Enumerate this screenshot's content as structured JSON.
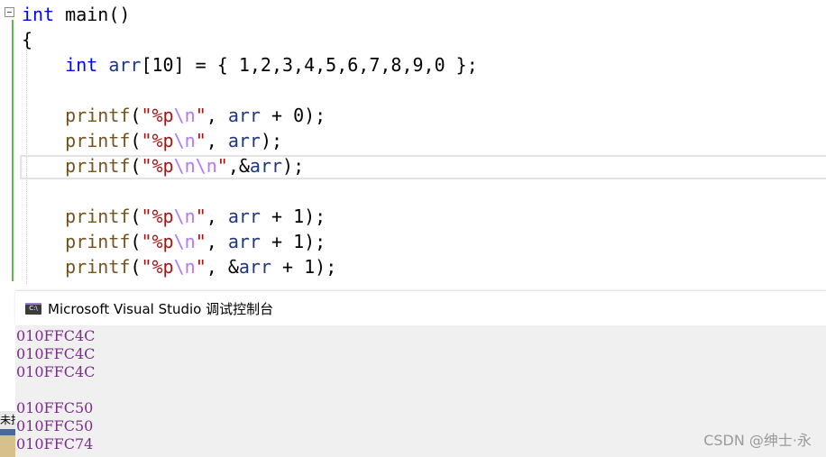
{
  "editor": {
    "lines": [
      {
        "tokens": [
          {
            "t": "int",
            "c": "kw"
          },
          {
            "t": " main()",
            "c": ""
          }
        ]
      },
      {
        "tokens": [
          {
            "t": "{",
            "c": ""
          }
        ]
      },
      {
        "tokens": [
          {
            "t": "    ",
            "c": ""
          },
          {
            "t": "int",
            "c": "kw"
          },
          {
            "t": " ",
            "c": ""
          },
          {
            "t": "arr",
            "c": "var"
          },
          {
            "t": "[10] = { 1,2,3,4,5,6,7,8,9,0 };",
            "c": ""
          }
        ]
      },
      {
        "tokens": []
      },
      {
        "tokens": [
          {
            "t": "    ",
            "c": ""
          },
          {
            "t": "printf",
            "c": "fn"
          },
          {
            "t": "(",
            "c": ""
          },
          {
            "t": "\"%p",
            "c": "str"
          },
          {
            "t": "\\n",
            "c": "esc"
          },
          {
            "t": "\"",
            "c": "str"
          },
          {
            "t": ", ",
            "c": ""
          },
          {
            "t": "arr",
            "c": "var"
          },
          {
            "t": " + 0);",
            "c": ""
          }
        ]
      },
      {
        "tokens": [
          {
            "t": "    ",
            "c": ""
          },
          {
            "t": "printf",
            "c": "fn"
          },
          {
            "t": "(",
            "c": ""
          },
          {
            "t": "\"%p",
            "c": "str"
          },
          {
            "t": "\\n",
            "c": "esc"
          },
          {
            "t": "\"",
            "c": "str"
          },
          {
            "t": ", ",
            "c": ""
          },
          {
            "t": "arr",
            "c": "var"
          },
          {
            "t": ");",
            "c": ""
          }
        ]
      },
      {
        "tokens": [
          {
            "t": "    ",
            "c": ""
          },
          {
            "t": "printf",
            "c": "fn"
          },
          {
            "t": "(",
            "c": ""
          },
          {
            "t": "\"%p",
            "c": "str"
          },
          {
            "t": "\\n\\n",
            "c": "esc"
          },
          {
            "t": "\"",
            "c": "str"
          },
          {
            "t": ",&",
            "c": ""
          },
          {
            "t": "arr",
            "c": "var"
          },
          {
            "t": ");",
            "c": ""
          }
        ]
      },
      {
        "tokens": []
      },
      {
        "tokens": [
          {
            "t": "    ",
            "c": ""
          },
          {
            "t": "printf",
            "c": "fn"
          },
          {
            "t": "(",
            "c": ""
          },
          {
            "t": "\"%p",
            "c": "str"
          },
          {
            "t": "\\n",
            "c": "esc"
          },
          {
            "t": "\"",
            "c": "str"
          },
          {
            "t": ", ",
            "c": ""
          },
          {
            "t": "arr",
            "c": "var"
          },
          {
            "t": " + 1);",
            "c": ""
          }
        ]
      },
      {
        "tokens": [
          {
            "t": "    ",
            "c": ""
          },
          {
            "t": "printf",
            "c": "fn"
          },
          {
            "t": "(",
            "c": ""
          },
          {
            "t": "\"%p",
            "c": "str"
          },
          {
            "t": "\\n",
            "c": "esc"
          },
          {
            "t": "\"",
            "c": "str"
          },
          {
            "t": ", ",
            "c": ""
          },
          {
            "t": "arr",
            "c": "var"
          },
          {
            "t": " + 1);",
            "c": ""
          }
        ]
      },
      {
        "tokens": [
          {
            "t": "    ",
            "c": ""
          },
          {
            "t": "printf",
            "c": "fn"
          },
          {
            "t": "(",
            "c": ""
          },
          {
            "t": "\"%p",
            "c": "str"
          },
          {
            "t": "\\n",
            "c": "esc"
          },
          {
            "t": "\"",
            "c": "str"
          },
          {
            "t": ", &",
            "c": ""
          },
          {
            "t": "arr",
            "c": "var"
          },
          {
            "t": " + 1);",
            "c": ""
          }
        ]
      }
    ]
  },
  "console": {
    "title": "Microsoft Visual Studio 调试控制台",
    "icon": "console-window-icon",
    "output": [
      "010FFC4C",
      "010FFC4C",
      "010FFC4C",
      "",
      "010FFC50",
      "010FFC50",
      "010FFC74"
    ]
  },
  "left_tab": {
    "label": "未找"
  },
  "watermark": "CSDN @绅士·永",
  "colors": {
    "keyword": "#0000ff",
    "function": "#74531f",
    "string": "#a31515",
    "escape": "#b776fb",
    "variable": "#1f377f",
    "console_text": "#7f2b8f",
    "change_bar": "#5dbb4d"
  }
}
